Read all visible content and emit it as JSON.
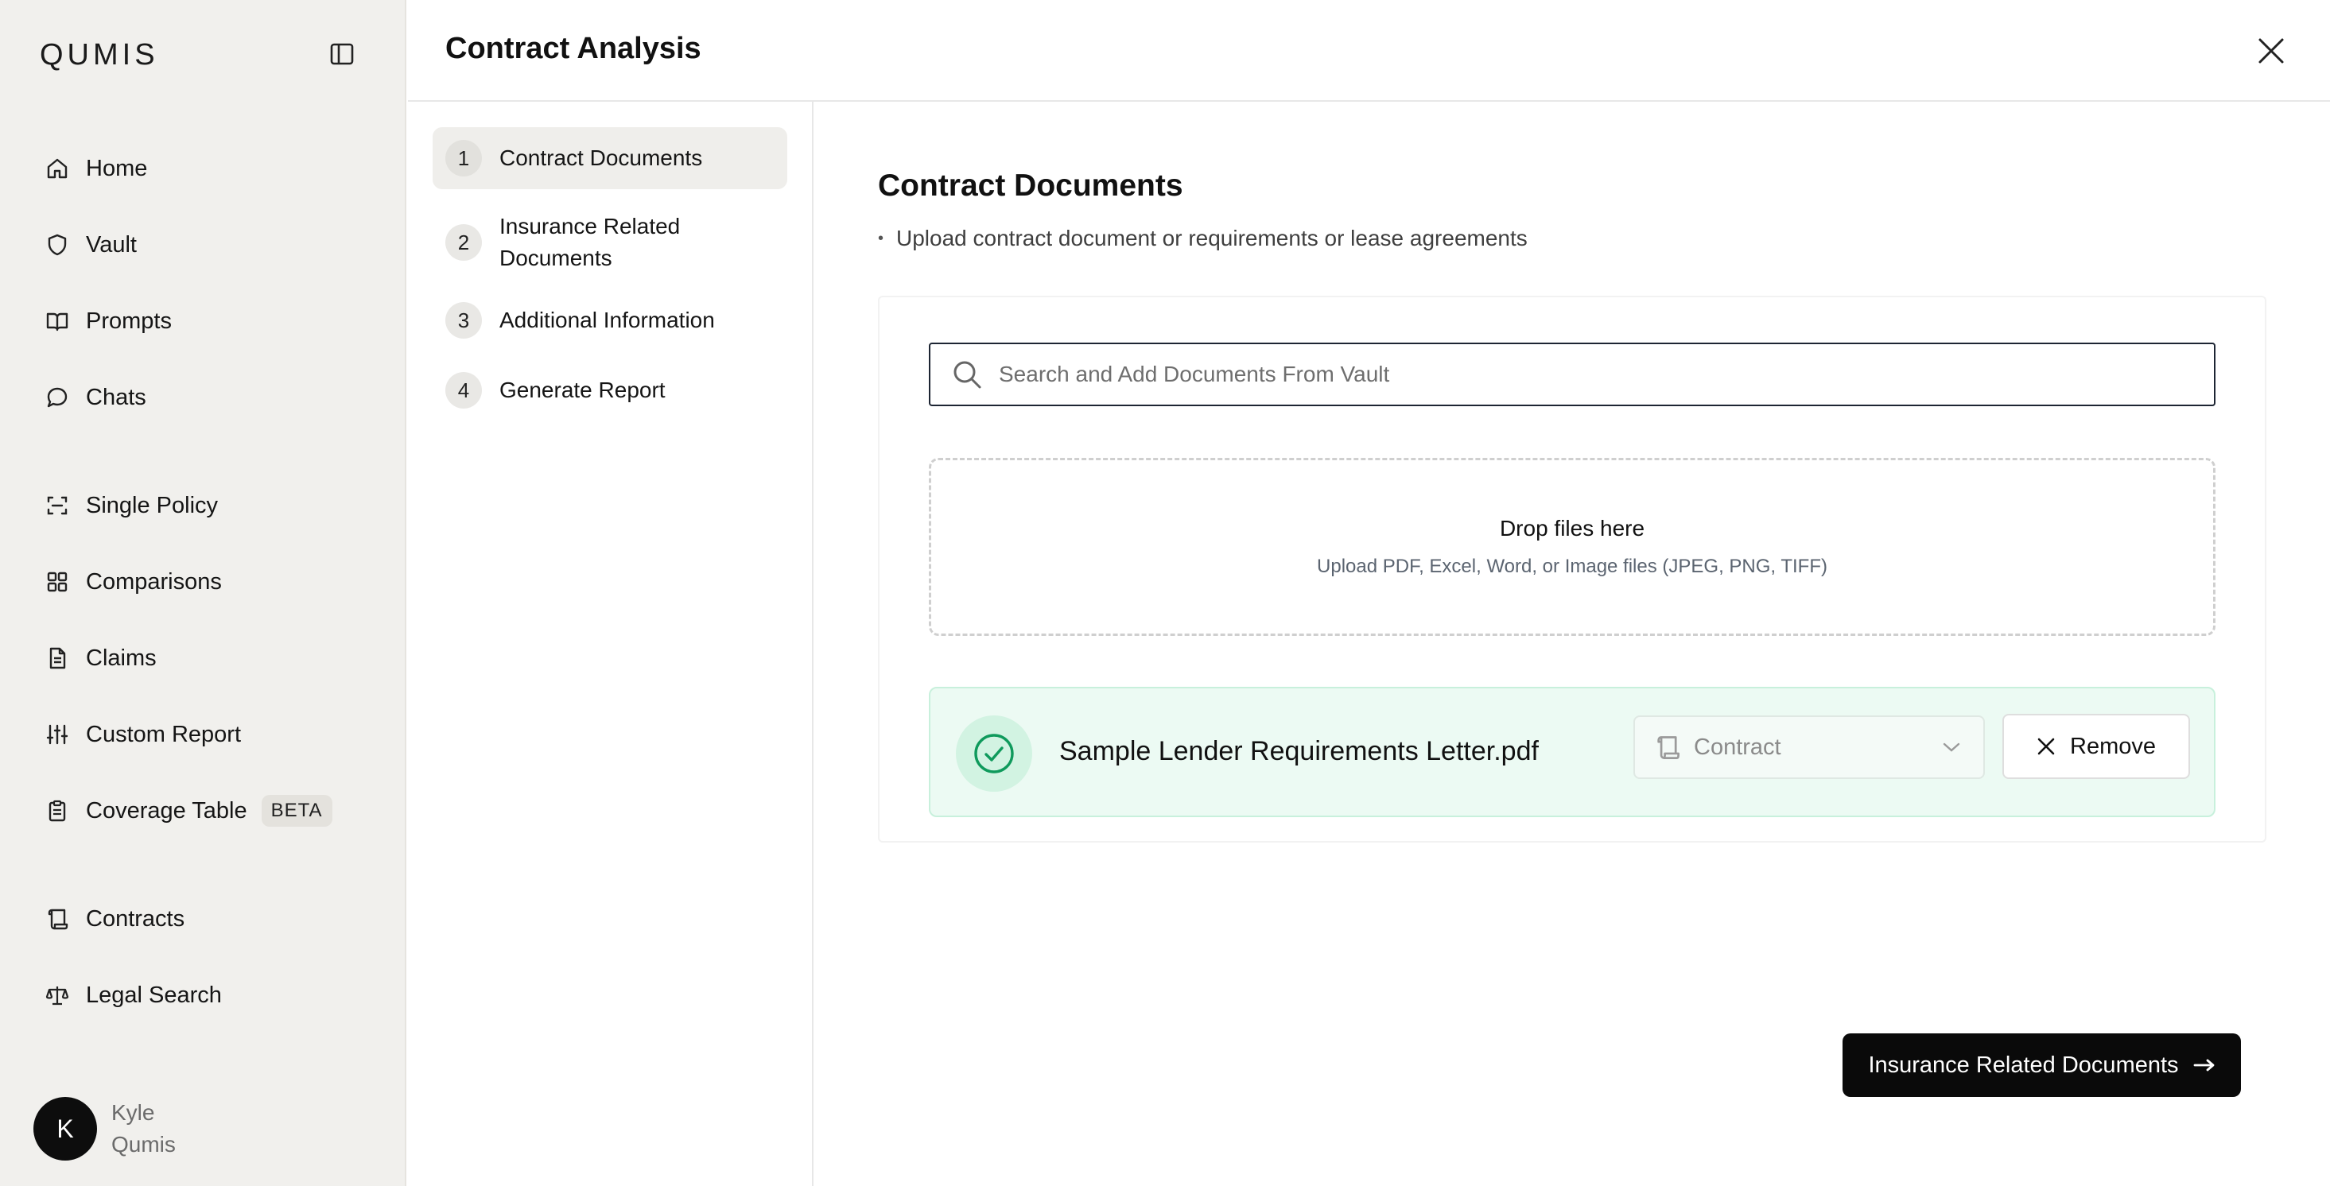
{
  "app": {
    "logo": "QUMIS"
  },
  "sidebar": {
    "collapse_icon": "sidebar-toggle-icon",
    "items": [
      {
        "label": "Home",
        "icon": "home-icon"
      },
      {
        "label": "Vault",
        "icon": "shield-icon"
      },
      {
        "label": "Prompts",
        "icon": "book-icon"
      },
      {
        "label": "Chats",
        "icon": "chat-bubble-icon"
      },
      {
        "label": "Single Policy",
        "icon": "scan-icon"
      },
      {
        "label": "Comparisons",
        "icon": "grid-icon"
      },
      {
        "label": "Claims",
        "icon": "document-icon"
      },
      {
        "label": "Custom Report",
        "icon": "sliders-icon"
      },
      {
        "label": "Coverage Table",
        "icon": "clipboard-icon",
        "badge": "BETA"
      },
      {
        "label": "Contracts",
        "icon": "scroll-icon"
      },
      {
        "label": "Legal Search",
        "icon": "scale-icon"
      }
    ],
    "user": {
      "initial": "K",
      "first_name": "Kyle",
      "last_name": "Qumis"
    }
  },
  "header": {
    "title": "Contract Analysis"
  },
  "steps": [
    {
      "number": "1",
      "label": "Contract Documents",
      "active": true
    },
    {
      "number": "2",
      "label": "Insurance Related Documents",
      "active": false
    },
    {
      "number": "3",
      "label": "Additional Information",
      "active": false
    },
    {
      "number": "4",
      "label": "Generate Report",
      "active": false
    }
  ],
  "main": {
    "section_title": "Contract Documents",
    "bullet": "Upload contract document or requirements or lease agreements",
    "search": {
      "placeholder": "Search and Add Documents From Vault"
    },
    "dropzone": {
      "title": "Drop files here",
      "subtitle": "Upload PDF, Excel, Word, or Image files (JPEG, PNG, TIFF)"
    },
    "file": {
      "name": "Sample Lender Requirements Letter.pdf",
      "type": "Contract",
      "remove_label": "Remove"
    },
    "next_button": "Insurance Related Documents"
  },
  "colors": {
    "sidebar_bg": "#f1f0ed",
    "success_bg": "#ecfaf3",
    "success_accent": "#0f9a5c",
    "primary_button": "#0a0a0a"
  }
}
